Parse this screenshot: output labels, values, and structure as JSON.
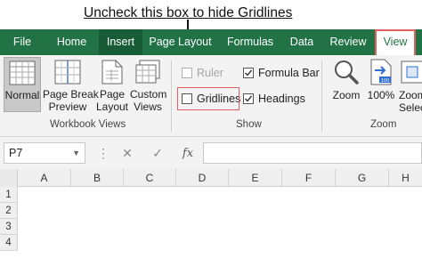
{
  "annotation": "Uncheck this box to hide Gridlines",
  "tabs": [
    "File",
    "Home",
    "Insert",
    "Page Layout",
    "Formulas",
    "Data",
    "Review",
    "View"
  ],
  "workbook_views": {
    "label": "Workbook Views",
    "normal": "Normal",
    "page_break_1": "Page Break",
    "page_break_2": "Preview",
    "page_layout_1": "Page",
    "page_layout_2": "Layout",
    "custom_1": "Custom",
    "custom_2": "Views"
  },
  "show": {
    "label": "Show",
    "ruler": "Ruler",
    "gridlines": "Gridlines",
    "formula_bar": "Formula Bar",
    "headings": "Headings"
  },
  "zoom": {
    "label": "Zoom",
    "zoom": "Zoom",
    "hundred": "100%",
    "zoom_sel_1": "Zoom",
    "zoom_sel_2": "Selec"
  },
  "namebox": "P7",
  "fx_symbol": "fx",
  "columns": [
    "A",
    "B",
    "C",
    "D",
    "E",
    "F",
    "G",
    "H"
  ],
  "rows": [
    "1",
    "2",
    "3",
    "4"
  ]
}
